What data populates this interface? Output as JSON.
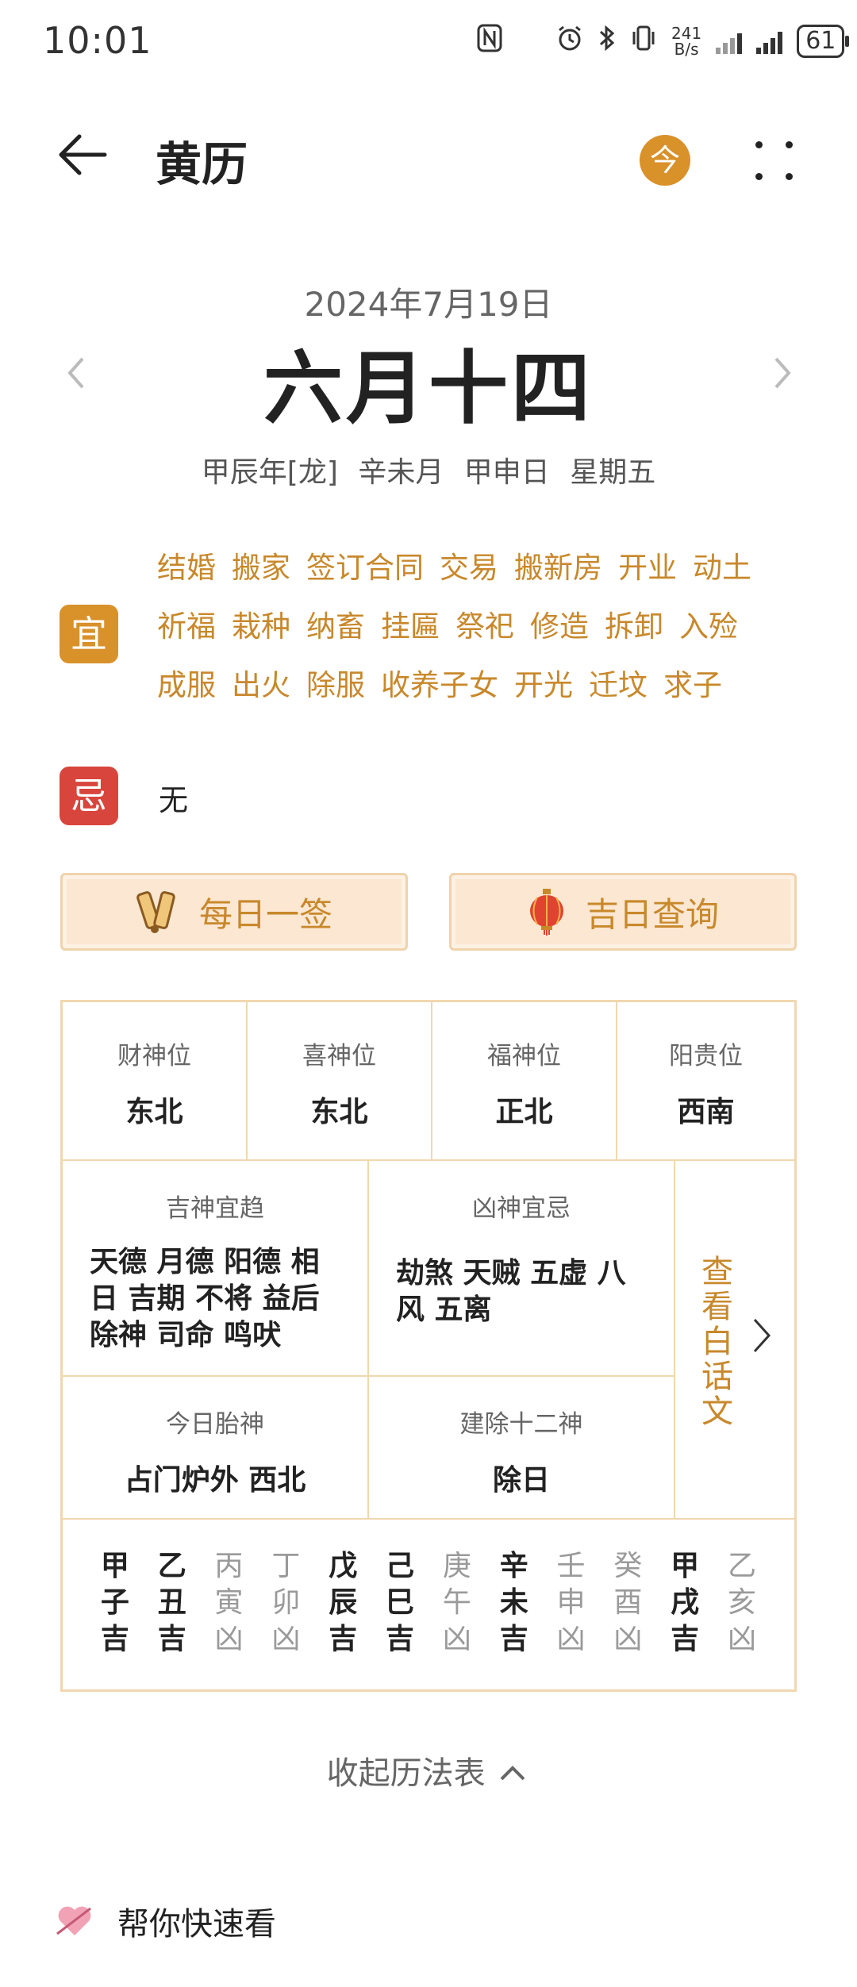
{
  "status_bar": {
    "time": "10:01",
    "net_speed_value": "241",
    "net_speed_unit": "B/s",
    "battery": "61"
  },
  "app_bar": {
    "title": "黄历",
    "today_label": "今"
  },
  "date": {
    "solar": "2024年7月19日",
    "lunar": "六月十四",
    "ganzhi": "甲辰年[龙]  辛未月  甲申日  星期五"
  },
  "yi": {
    "label": "宜",
    "items": [
      "结婚",
      "搬家",
      "签订合同",
      "交易",
      "搬新房",
      "开业",
      "动土",
      "祈福",
      "栽种",
      "纳畜",
      "挂匾",
      "祭祀",
      "修造",
      "拆卸",
      "入殓",
      "成服",
      "出火",
      "除服",
      "收养子女",
      "开光",
      "迁坟",
      "求子"
    ]
  },
  "ji": {
    "label": "忌",
    "text": "无"
  },
  "buttons": {
    "daily_sign": "每日一签",
    "lucky_day": "吉日查询"
  },
  "positions": {
    "wealth": {
      "label": "财神位",
      "value": "东北"
    },
    "joy": {
      "label": "喜神位",
      "value": "东北"
    },
    "fortune": {
      "label": "福神位",
      "value": "正北"
    },
    "noble": {
      "label": "阳贵位",
      "value": "西南"
    }
  },
  "spirits": {
    "good_label": "吉神宜趋",
    "good_value": "天德 月德 阳德 相日 吉期 不将 益后除神 司命 鸣吠",
    "bad_label": "凶神宜忌",
    "bad_value": "劫煞 天贼 五虚 八风 五离",
    "fetus_label": "今日胎神",
    "fetus_value": "占门炉外 西北",
    "twelve_label": "建除十二神",
    "twelve_value": "除日",
    "view_plain": "查看白话文"
  },
  "hours": [
    {
      "g": "甲",
      "z": "子",
      "r": "吉"
    },
    {
      "g": "乙",
      "z": "丑",
      "r": "吉"
    },
    {
      "g": "丙",
      "z": "寅",
      "r": "凶"
    },
    {
      "g": "丁",
      "z": "卯",
      "r": "凶"
    },
    {
      "g": "戊",
      "z": "辰",
      "r": "吉"
    },
    {
      "g": "己",
      "z": "巳",
      "r": "吉"
    },
    {
      "g": "庚",
      "z": "午",
      "r": "凶"
    },
    {
      "g": "辛",
      "z": "未",
      "r": "吉"
    },
    {
      "g": "壬",
      "z": "申",
      "r": "凶"
    },
    {
      "g": "癸",
      "z": "酉",
      "r": "凶"
    },
    {
      "g": "甲",
      "z": "戌",
      "r": "吉"
    },
    {
      "g": "乙",
      "z": "亥",
      "r": "凶"
    }
  ],
  "collapse_label": "收起历法表",
  "bottom_label": "帮你快速看",
  "colors": {
    "accent": "#d9912a",
    "danger": "#d8453c",
    "border": "#f1d7b0"
  }
}
